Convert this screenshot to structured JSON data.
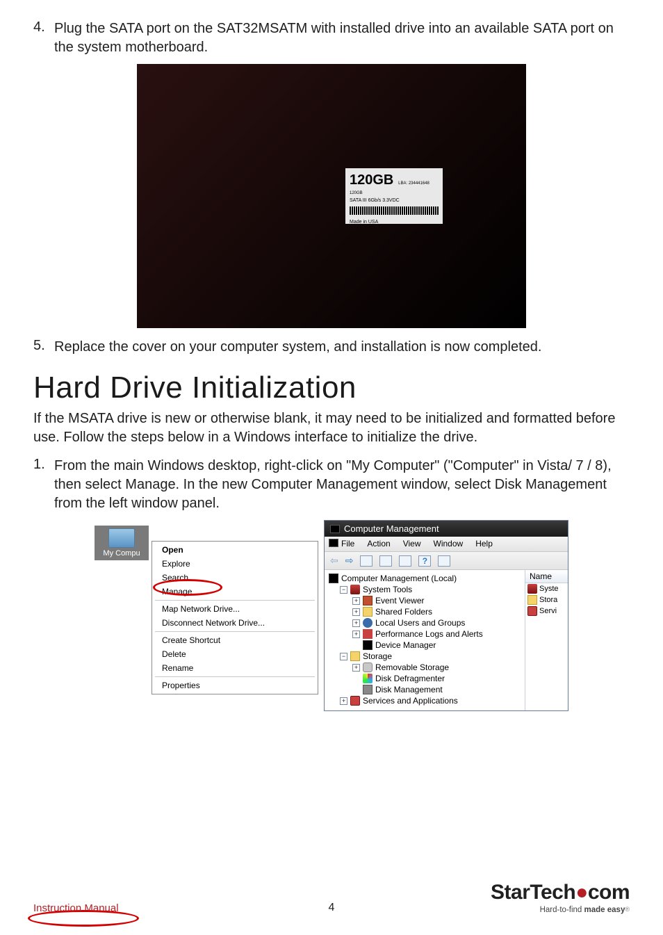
{
  "step4": {
    "num": "4.",
    "text": "Plug the SATA port on the SAT32MSATM with installed drive into an available SATA port on the system motherboard."
  },
  "photo": {
    "ssd_big": "120GB",
    "ssd_line1": "SATA III 6Gb/s   3.3VDC",
    "ssd_line2": "LBA: 234441648 120GB",
    "ssd_made": "Made in USA"
  },
  "step5": {
    "num": "5.",
    "text": "Replace the cover on your computer system, and installation is now completed."
  },
  "heading": "Hard Drive Initialization",
  "intro": "If the MSATA drive is new or otherwise blank, it may need to be initialized and formatted before use.  Follow the steps below in a Windows interface to initialize the drive.",
  "step1": {
    "num": "1.",
    "text": "From the main Windows desktop, right-click on \"My Computer\" (\"Computer\" in Vista/ 7 / 8), then select Manage. In the new Computer Management window, select Disk Management from the left window panel."
  },
  "ctx": {
    "icon_label": "My Compu",
    "items": {
      "open": "Open",
      "explore": "Explore",
      "search": "Search...",
      "manage": "Manage",
      "map": "Map Network Drive...",
      "disconnect": "Disconnect Network Drive...",
      "shortcut": "Create Shortcut",
      "delete": "Delete",
      "rename": "Rename",
      "properties": "Properties"
    }
  },
  "mgmt": {
    "title": "Computer Management",
    "menu": {
      "file": "File",
      "action": "Action",
      "view": "View",
      "window": "Window",
      "help": "Help"
    },
    "tree": {
      "root": "Computer Management (Local)",
      "system_tools": "System Tools",
      "event_viewer": "Event Viewer",
      "shared_folders": "Shared Folders",
      "local_users": "Local Users and Groups",
      "perf_logs": "Performance Logs and Alerts",
      "device_manager": "Device Manager",
      "storage": "Storage",
      "removable": "Removable Storage",
      "defrag": "Disk Defragmenter",
      "disk_mgmt": "Disk Management",
      "services": "Services and Applications"
    },
    "name_col": {
      "header": "Name",
      "r1": "Syste",
      "r2": "Stora",
      "r3": "Servi"
    }
  },
  "footer": {
    "left": "Instruction Manual",
    "page": "4",
    "brand_main": "StarTech",
    "brand_dot": "●",
    "brand_suffix": "com",
    "tagline_a": "Hard-to-find ",
    "tagline_b": "made easy",
    "reg": "®"
  }
}
